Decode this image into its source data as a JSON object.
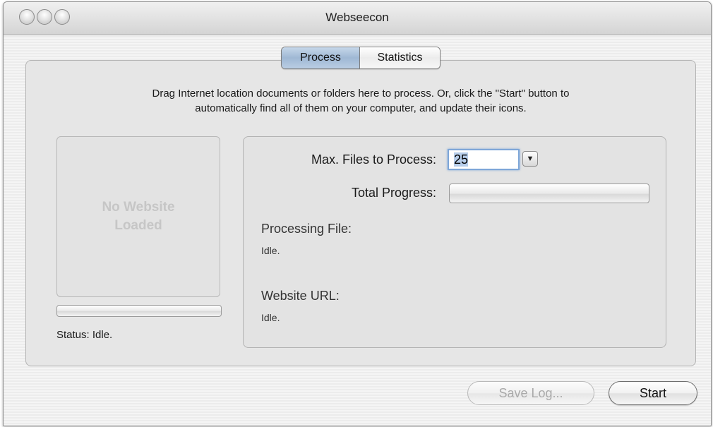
{
  "window": {
    "title": "Webseecon"
  },
  "tabs": [
    {
      "label": "Process",
      "active": true
    },
    {
      "label": "Statistics",
      "active": false
    }
  ],
  "instructions": {
    "line1": "Drag Internet location documents or folders here to process. Or, click the \"Start\" button to",
    "line2": "automatically find all of them on your computer, and update their icons."
  },
  "preview": {
    "line1": "No Website",
    "line2": "Loaded"
  },
  "status": {
    "text": "Status: Idle.",
    "progress": 0
  },
  "settings": {
    "max_files_label": "Max. Files to Process:",
    "max_files_value": "25",
    "total_progress_label": "Total Progress:",
    "total_progress_value": 0
  },
  "processing": {
    "file_label": "Processing File:",
    "file_value": "Idle.",
    "url_label": "Website URL:",
    "url_value": "Idle."
  },
  "buttons": {
    "save_log": "Save Log...",
    "start": "Start"
  },
  "colors": {
    "tab_active": "#9fb8d4",
    "focus_ring": "#7ea6d8",
    "selection": "#b6cdea"
  }
}
